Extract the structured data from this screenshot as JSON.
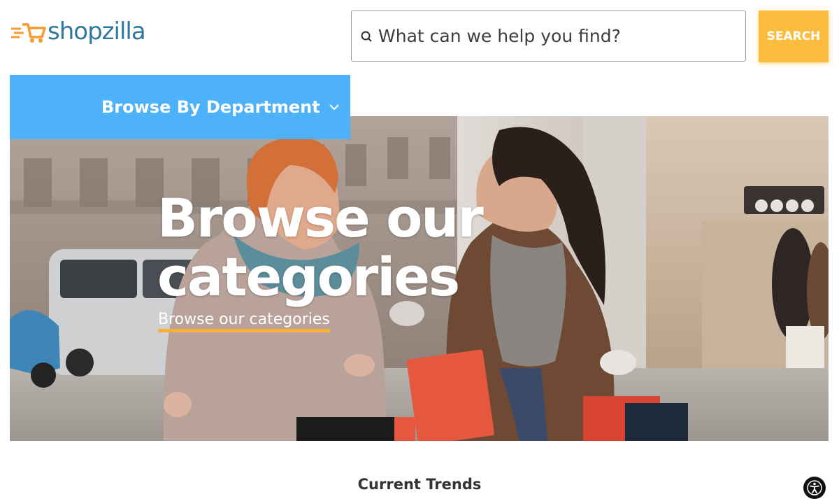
{
  "header": {
    "logo_text": "shopzilla",
    "search_placeholder": "What can we help you find?",
    "search_button_label": "SEARCH"
  },
  "nav": {
    "department_label": "Browse By Department"
  },
  "hero": {
    "title_line1": "Browse our",
    "title_line2": "categories",
    "link_label": "Browse our categories"
  },
  "sections": {
    "trends_title": "Current Trends"
  },
  "icons": {
    "logo": "shopping-cart-icon",
    "search": "search-icon",
    "dropdown": "chevron-down-icon",
    "accessibility": "accessibility-icon"
  },
  "colors": {
    "brand_text": "#2f7a9b",
    "accent_orange": "#fcbd3e",
    "department_blue": "#4db2f9"
  }
}
